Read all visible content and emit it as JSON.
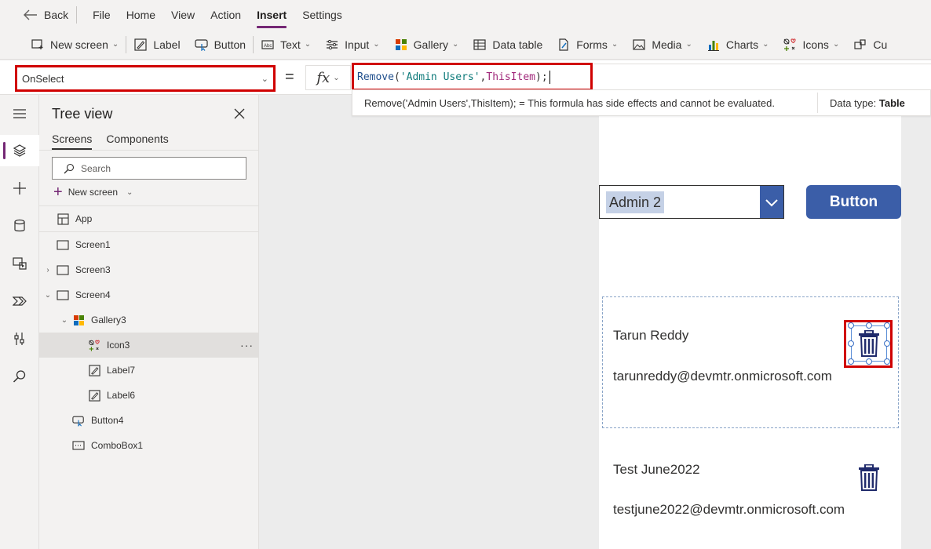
{
  "menubar": {
    "back": "Back",
    "items": [
      "File",
      "Home",
      "View",
      "Action",
      "Insert",
      "Settings"
    ],
    "active": "Insert"
  },
  "ribbon": {
    "new_screen": "New screen",
    "label": "Label",
    "button": "Button",
    "text": "Text",
    "input": "Input",
    "gallery": "Gallery",
    "data_table": "Data table",
    "forms": "Forms",
    "media": "Media",
    "charts": "Charts",
    "icons": "Icons",
    "custom": "Cu"
  },
  "formula": {
    "property": "OnSelect",
    "equals": "=",
    "fx": "fx",
    "fn": "Remove",
    "open": "(",
    "arg1": "'Admin Users'",
    "comma": ",",
    "arg2": "ThisItem",
    "close": ");",
    "hint_message": "Remove('Admin Users',ThisItem);  =  This formula has side effects and cannot be evaluated.",
    "data_type_label": "Data type:",
    "data_type_value": "Table"
  },
  "tree": {
    "title": "Tree view",
    "tabs": [
      "Screens",
      "Components"
    ],
    "search_placeholder": "Search",
    "new_screen": "New screen",
    "nodes": [
      "App",
      "Screen1",
      "Screen3",
      "Screen4",
      "Gallery3",
      "Icon3",
      "Label7",
      "Label6",
      "Button4",
      "ComboBox1"
    ],
    "selected": "Icon3"
  },
  "canvas": {
    "combo_value": "Admin 2",
    "button_label": "Button",
    "items": [
      {
        "name": "Tarun Reddy",
        "email": "tarunreddy@devmtr.onmicrosoft.com"
      },
      {
        "name": "Test June2022",
        "email": "testjune2022@devmtr.onmicrosoft.com"
      }
    ]
  },
  "colors": {
    "accent": "#742774",
    "highlight_border": "#d00000",
    "primary_button": "#3b5ea8",
    "trash_icon": "#1f2a6b"
  }
}
